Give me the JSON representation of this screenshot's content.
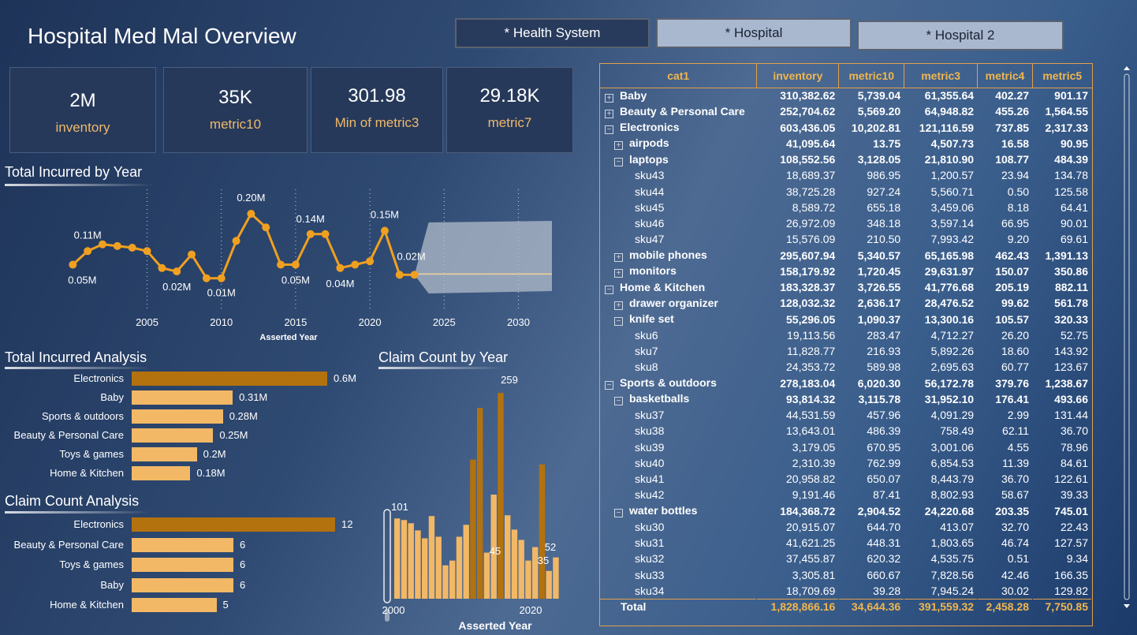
{
  "page_title": "Hospital Med Mal Overview",
  "slicers": [
    {
      "label": "* Health System"
    },
    {
      "label": "* Hospital"
    },
    {
      "label": "* Hospital 2"
    }
  ],
  "kpis": [
    {
      "value": "2M",
      "label": "inventory"
    },
    {
      "value": "35K",
      "label": "metric10"
    },
    {
      "value": "301.98",
      "label": "Min of metric3"
    },
    {
      "value": "29.18K",
      "label": "metric7"
    }
  ],
  "line_chart": {
    "title": "Total Incurred by Year",
    "xlabel": "Asserted Year",
    "ticks": [
      "2005",
      "2010",
      "2015",
      "2020",
      "2025",
      "2030"
    ],
    "labels": [
      "0.05M",
      "0.11M",
      "0.02M",
      "0.01M",
      "0.20M",
      "0.05M",
      "0.14M",
      "0.04M",
      "0.15M",
      "0.02M"
    ]
  },
  "bar_chart_1": {
    "title": "Total Incurred Analysis",
    "items": [
      {
        "label": "Electronics",
        "value": "0.6M"
      },
      {
        "label": "Baby",
        "value": "0.31M"
      },
      {
        "label": "Sports & outdoors",
        "value": "0.28M"
      },
      {
        "label": "Beauty & Personal Care",
        "value": "0.25M"
      },
      {
        "label": "Toys & games",
        "value": "0.2M"
      },
      {
        "label": "Home & Kitchen",
        "value": "0.18M"
      }
    ]
  },
  "bar_chart_2": {
    "title": "Claim Count Analysis",
    "items": [
      {
        "label": "Electronics",
        "value": "12"
      },
      {
        "label": "Beauty & Personal Care",
        "value": "6"
      },
      {
        "label": "Toys & games",
        "value": "6"
      },
      {
        "label": "Baby",
        "value": "6"
      },
      {
        "label": "Home & Kitchen",
        "value": "5"
      }
    ]
  },
  "column_chart": {
    "title": "Claim Count by Year",
    "xlabel": "Asserted Year",
    "ticks": [
      "2000",
      "2020"
    ],
    "labels": [
      "101",
      "259",
      "45",
      "52",
      "35"
    ]
  },
  "chart_data": [
    {
      "type": "line",
      "title": "Total Incurred by Year",
      "xlabel": "Asserted Year",
      "ylabel": "",
      "x": [
        2000,
        2001,
        2002,
        2003,
        2004,
        2005,
        2006,
        2007,
        2008,
        2009,
        2010,
        2011,
        2012,
        2013,
        2014,
        2015,
        2016,
        2017,
        2018,
        2019,
        2020,
        2021,
        2022,
        2023
      ],
      "values": [
        0.05,
        0.09,
        0.11,
        0.105,
        0.1,
        0.09,
        0.04,
        0.03,
        0.08,
        0.01,
        0.01,
        0.12,
        0.2,
        0.16,
        0.05,
        0.05,
        0.14,
        0.14,
        0.04,
        0.05,
        0.06,
        0.15,
        0.02,
        0.02
      ],
      "xlim": [
        1996,
        2033
      ],
      "unit": "M",
      "forecast_band": [
        2023,
        2033
      ]
    },
    {
      "type": "bar",
      "title": "Total Incurred Analysis",
      "categories": [
        "Electronics",
        "Baby",
        "Sports & outdoors",
        "Beauty & Personal Care",
        "Toys & games",
        "Home & Kitchen"
      ],
      "values": [
        0.6,
        0.31,
        0.28,
        0.25,
        0.2,
        0.18
      ],
      "xlim": [
        0,
        0.6
      ]
    },
    {
      "type": "bar",
      "title": "Claim Count Analysis",
      "categories": [
        "Electronics",
        "Beauty & Personal Care",
        "Toys & games",
        "Baby",
        "Home & Kitchen"
      ],
      "values": [
        12,
        6,
        6,
        6,
        5
      ],
      "xlim": [
        0,
        12
      ]
    },
    {
      "type": "bar",
      "title": "Claim Count by Year",
      "xlabel": "Asserted Year",
      "x": [
        2000,
        2001,
        2002,
        2003,
        2004,
        2005,
        2006,
        2007,
        2008,
        2009,
        2010,
        2011,
        2012,
        2013,
        2014,
        2015,
        2016,
        2017,
        2018,
        2019,
        2020,
        2021,
        2022,
        2023
      ],
      "values": [
        101,
        99,
        95,
        86,
        76,
        104,
        78,
        42,
        48,
        78,
        93,
        175,
        240,
        58,
        131,
        259,
        105,
        87,
        74,
        48,
        65,
        169,
        35,
        52
      ],
      "ylim": [
        0,
        270
      ]
    }
  ],
  "table": {
    "columns": [
      "cat1",
      "inventory",
      "metric10",
      "metric3",
      "metric4",
      "metric5"
    ],
    "rows": [
      {
        "level": 0,
        "exp": "+",
        "bold": true,
        "name": "Baby",
        "v": [
          "310,382.62",
          "5,739.04",
          "61,355.64",
          "402.27",
          "901.17"
        ]
      },
      {
        "level": 0,
        "exp": "+",
        "bold": true,
        "name": "Beauty & Personal Care",
        "v": [
          "252,704.62",
          "5,569.20",
          "64,948.82",
          "455.26",
          "1,564.55"
        ]
      },
      {
        "level": 0,
        "exp": "−",
        "bold": true,
        "name": "Electronics",
        "v": [
          "603,436.05",
          "10,202.81",
          "121,116.59",
          "737.85",
          "2,317.33"
        ]
      },
      {
        "level": 1,
        "exp": "+",
        "bold": true,
        "name": "airpods",
        "v": [
          "41,095.64",
          "13.75",
          "4,507.73",
          "16.58",
          "90.95"
        ]
      },
      {
        "level": 1,
        "exp": "−",
        "bold": true,
        "name": "laptops",
        "v": [
          "108,552.56",
          "3,128.05",
          "21,810.90",
          "108.77",
          "484.39"
        ]
      },
      {
        "level": 2,
        "exp": "",
        "bold": false,
        "name": "sku43",
        "v": [
          "18,689.37",
          "986.95",
          "1,200.57",
          "23.94",
          "134.78"
        ]
      },
      {
        "level": 2,
        "exp": "",
        "bold": false,
        "name": "sku44",
        "v": [
          "38,725.28",
          "927.24",
          "5,560.71",
          "0.50",
          "125.58"
        ]
      },
      {
        "level": 2,
        "exp": "",
        "bold": false,
        "name": "sku45",
        "v": [
          "8,589.72",
          "655.18",
          "3,459.06",
          "8.18",
          "64.41"
        ]
      },
      {
        "level": 2,
        "exp": "",
        "bold": false,
        "name": "sku46",
        "v": [
          "26,972.09",
          "348.18",
          "3,597.14",
          "66.95",
          "90.01"
        ]
      },
      {
        "level": 2,
        "exp": "",
        "bold": false,
        "name": "sku47",
        "v": [
          "15,576.09",
          "210.50",
          "7,993.42",
          "9.20",
          "69.61"
        ]
      },
      {
        "level": 1,
        "exp": "+",
        "bold": true,
        "name": "mobile phones",
        "v": [
          "295,607.94",
          "5,340.57",
          "65,165.98",
          "462.43",
          "1,391.13"
        ]
      },
      {
        "level": 1,
        "exp": "+",
        "bold": true,
        "name": "monitors",
        "v": [
          "158,179.92",
          "1,720.45",
          "29,631.97",
          "150.07",
          "350.86"
        ]
      },
      {
        "level": 0,
        "exp": "−",
        "bold": true,
        "name": "Home & Kitchen",
        "v": [
          "183,328.37",
          "3,726.55",
          "41,776.68",
          "205.19",
          "882.11"
        ]
      },
      {
        "level": 1,
        "exp": "+",
        "bold": true,
        "name": "drawer organizer",
        "v": [
          "128,032.32",
          "2,636.17",
          "28,476.52",
          "99.62",
          "561.78"
        ]
      },
      {
        "level": 1,
        "exp": "−",
        "bold": true,
        "name": "knife set",
        "v": [
          "55,296.05",
          "1,090.37",
          "13,300.16",
          "105.57",
          "320.33"
        ]
      },
      {
        "level": 2,
        "exp": "",
        "bold": false,
        "name": "sku6",
        "v": [
          "19,113.56",
          "283.47",
          "4,712.27",
          "26.20",
          "52.75"
        ]
      },
      {
        "level": 2,
        "exp": "",
        "bold": false,
        "name": "sku7",
        "v": [
          "11,828.77",
          "216.93",
          "5,892.26",
          "18.60",
          "143.92"
        ]
      },
      {
        "level": 2,
        "exp": "",
        "bold": false,
        "name": "sku8",
        "v": [
          "24,353.72",
          "589.98",
          "2,695.63",
          "60.77",
          "123.67"
        ]
      },
      {
        "level": 0,
        "exp": "−",
        "bold": true,
        "name": "Sports & outdoors",
        "v": [
          "278,183.04",
          "6,020.30",
          "56,172.78",
          "379.76",
          "1,238.67"
        ]
      },
      {
        "level": 1,
        "exp": "−",
        "bold": true,
        "name": "basketballs",
        "v": [
          "93,814.32",
          "3,115.78",
          "31,952.10",
          "176.41",
          "493.66"
        ]
      },
      {
        "level": 2,
        "exp": "",
        "bold": false,
        "name": "sku37",
        "v": [
          "44,531.59",
          "457.96",
          "4,091.29",
          "2.99",
          "131.44"
        ]
      },
      {
        "level": 2,
        "exp": "",
        "bold": false,
        "name": "sku38",
        "v": [
          "13,643.01",
          "486.39",
          "758.49",
          "62.11",
          "36.70"
        ]
      },
      {
        "level": 2,
        "exp": "",
        "bold": false,
        "name": "sku39",
        "v": [
          "3,179.05",
          "670.95",
          "3,001.06",
          "4.55",
          "78.96"
        ]
      },
      {
        "level": 2,
        "exp": "",
        "bold": false,
        "name": "sku40",
        "v": [
          "2,310.39",
          "762.99",
          "6,854.53",
          "11.39",
          "84.61"
        ]
      },
      {
        "level": 2,
        "exp": "",
        "bold": false,
        "name": "sku41",
        "v": [
          "20,958.82",
          "650.07",
          "8,443.79",
          "36.70",
          "122.61"
        ]
      },
      {
        "level": 2,
        "exp": "",
        "bold": false,
        "name": "sku42",
        "v": [
          "9,191.46",
          "87.41",
          "8,802.93",
          "58.67",
          "39.33"
        ]
      },
      {
        "level": 1,
        "exp": "−",
        "bold": true,
        "name": "water bottles",
        "v": [
          "184,368.72",
          "2,904.52",
          "24,220.68",
          "203.35",
          "745.01"
        ]
      },
      {
        "level": 2,
        "exp": "",
        "bold": false,
        "name": "sku30",
        "v": [
          "20,915.07",
          "644.70",
          "413.07",
          "32.70",
          "22.43"
        ]
      },
      {
        "level": 2,
        "exp": "",
        "bold": false,
        "name": "sku31",
        "v": [
          "41,621.25",
          "448.31",
          "1,803.65",
          "46.74",
          "127.57"
        ]
      },
      {
        "level": 2,
        "exp": "",
        "bold": false,
        "name": "sku32",
        "v": [
          "37,455.87",
          "620.32",
          "4,535.75",
          "0.51",
          "9.34"
        ]
      },
      {
        "level": 2,
        "exp": "",
        "bold": false,
        "name": "sku33",
        "v": [
          "3,305.81",
          "660.67",
          "7,828.56",
          "42.46",
          "166.35"
        ]
      },
      {
        "level": 2,
        "exp": "",
        "bold": false,
        "name": "sku34",
        "v": [
          "18,709.69",
          "39.28",
          "7,945.24",
          "30.02",
          "129.82"
        ]
      }
    ],
    "total": {
      "name": "Total",
      "v": [
        "1,828,866.16",
        "34,644.36",
        "391,559.32",
        "2,458.28",
        "7,750.85"
      ]
    }
  },
  "colors": {
    "accent": "#f0b64f",
    "bar_dark": "#b3720e",
    "bar_light": "#f2b866",
    "line": "#f0a020"
  }
}
